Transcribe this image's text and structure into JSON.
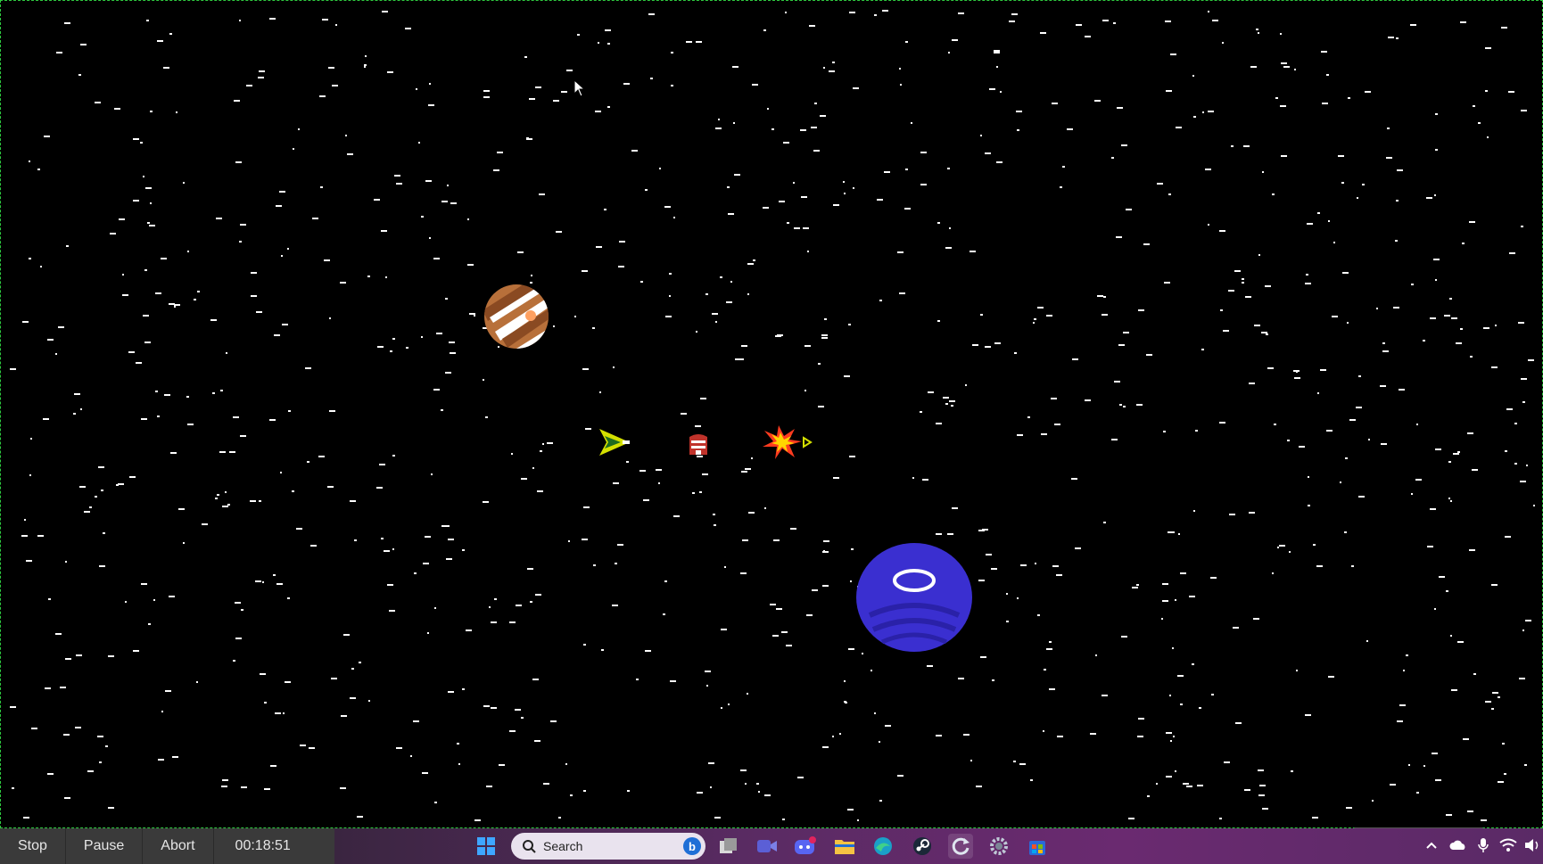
{
  "recorder": {
    "stop_label": "Stop",
    "pause_label": "Pause",
    "abort_label": "Abort",
    "elapsed": "00:18:51"
  },
  "scene": {
    "background_color": "#000000",
    "star_color": "#ffffff",
    "objects": [
      {
        "name": "striped-orange-planet",
        "colors": [
          "#b8703a",
          "#ffffff"
        ]
      },
      {
        "name": "blue-planet",
        "colors": [
          "#3a2fd0",
          "#ffffff"
        ]
      },
      {
        "name": "green-spaceship",
        "colors": [
          "#d4e000",
          "#1f6b1f"
        ]
      },
      {
        "name": "red-crate-enemy",
        "colors": [
          "#c0332b",
          "#ffffff"
        ]
      },
      {
        "name": "explosion-fireball",
        "colors": [
          "#ff3b1f",
          "#ffd400"
        ]
      }
    ]
  },
  "taskbar": {
    "search_placeholder": "Search",
    "apps": [
      "windows-start-icon",
      "bing-icon",
      "task-view-icon",
      "video-call-icon",
      "discord-icon",
      "file-explorer-icon",
      "edge-browser-icon",
      "steam-icon",
      "refresh-app-icon",
      "settings-icon",
      "store-icon"
    ],
    "tray": [
      "chevron-up-icon",
      "onedrive-icon",
      "microphone-icon",
      "wifi-icon",
      "speaker-icon"
    ],
    "accent": "#6a2a70"
  }
}
